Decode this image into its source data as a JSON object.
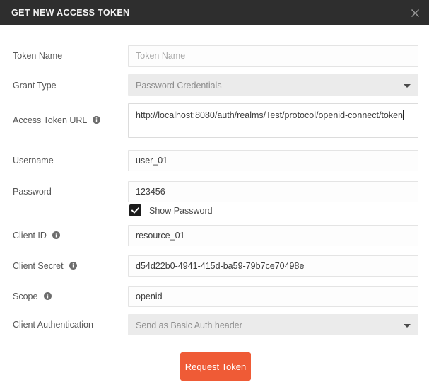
{
  "dialog": {
    "title": "GET NEW ACCESS TOKEN",
    "close_icon": "close-icon"
  },
  "colors": {
    "titlebar_bg": "#2e2e2e",
    "accent_button": "#ef5b36",
    "select_bg": "#ebebeb",
    "label_text": "#565656",
    "placeholder_text": "#a8a8a8"
  },
  "fields": {
    "token_name": {
      "label": "Token Name",
      "placeholder": "Token Name",
      "value": "Token Name",
      "type": "input",
      "has_info": false
    },
    "grant_type": {
      "label": "Grant Type",
      "value": "Password Credentials",
      "type": "select",
      "has_info": false
    },
    "access_token_url": {
      "label": "Access Token URL",
      "value": "http://localhost:8080/auth/realms/Test/protocol/openid-connect/token",
      "type": "textarea",
      "has_info": true,
      "info_icon": "info-icon"
    },
    "username": {
      "label": "Username",
      "value": "user_01",
      "type": "input",
      "has_info": false
    },
    "password": {
      "label": "Password",
      "value": "123456",
      "type": "input",
      "has_info": false
    },
    "show_password": {
      "label": "Show Password",
      "checked": true,
      "check_icon": "checkmark-icon"
    },
    "client_id": {
      "label": "Client ID",
      "value": "resource_01",
      "type": "input",
      "has_info": true,
      "info_icon": "info-icon"
    },
    "client_secret": {
      "label": "Client Secret",
      "value": "d54d22b0-4941-415d-ba59-79b7ce70498e",
      "type": "input",
      "has_info": true,
      "info_icon": "info-icon"
    },
    "scope": {
      "label": "Scope",
      "value": "openid",
      "type": "input",
      "has_info": true,
      "info_icon": "info-icon"
    },
    "client_authentication": {
      "label": "Client Authentication",
      "value": "Send as Basic Auth header",
      "type": "select",
      "has_info": false
    }
  },
  "actions": {
    "request_token": "Request Token"
  }
}
